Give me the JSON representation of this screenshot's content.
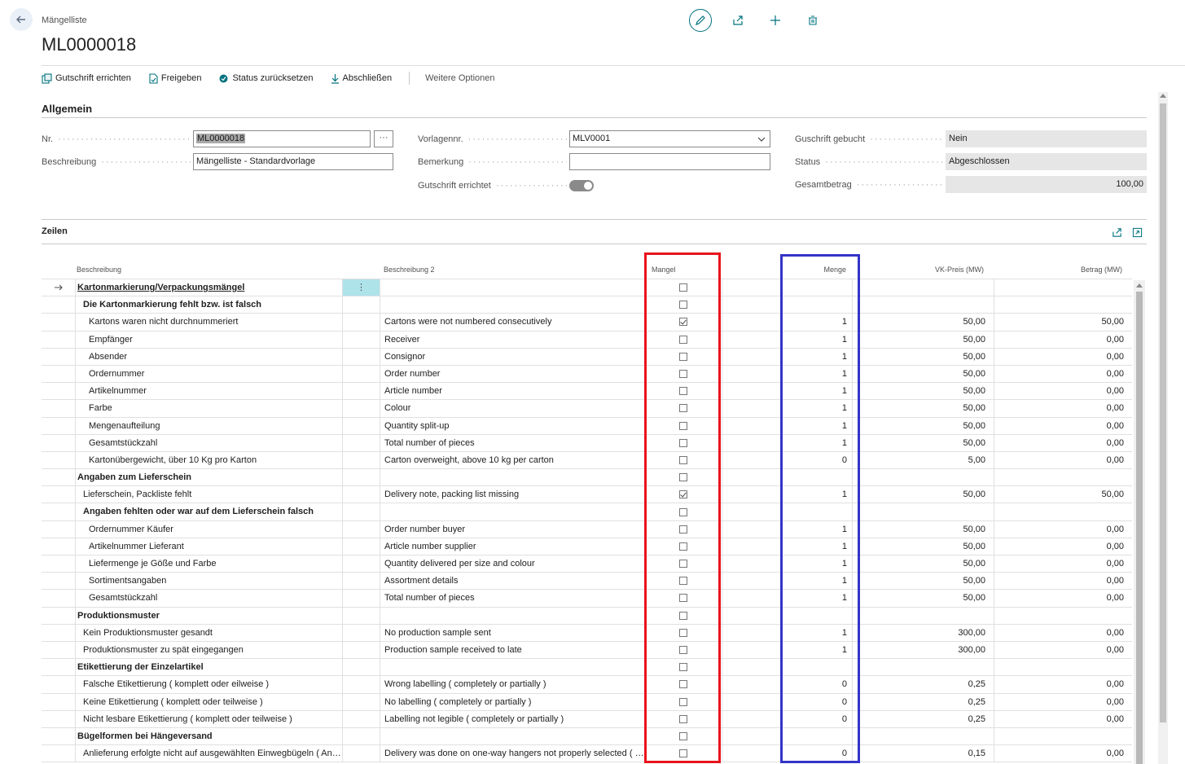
{
  "header": {
    "breadcrumb": "Mängelliste",
    "title": "ML0000018"
  },
  "toolbar": {
    "gutschrift": "Gutschrift errichten",
    "freigeben": "Freigeben",
    "status_reset": "Status zurücksetzen",
    "abschliessen": "Abschließen",
    "weitere": "Weitere Optionen"
  },
  "allgemein": {
    "section_title": "Allgemein",
    "nr_label": "Nr.",
    "nr_value": "ML0000018",
    "beschreibung_label": "Beschreibung",
    "beschreibung_value": "Mängelliste - Standardvorlage",
    "vorlagennr_label": "Vorlagennr.",
    "vorlagennr_value": "MLV0001",
    "bemerkung_label": "Bemerkung",
    "bemerkung_value": "",
    "gutschrift_errichtet_label": "Gutschrift errichtet",
    "guschrift_gebucht_label": "Guschrift gebucht",
    "guschrift_gebucht_value": "Nein",
    "status_label": "Status",
    "status_value": "Abgeschlossen",
    "gesamtbetrag_label": "Gesamtbetrag",
    "gesamtbetrag_value": "100,00"
  },
  "zeilen": {
    "section_title": "Zeilen",
    "columns": {
      "beschreibung": "Beschreibung",
      "beschreibung2": "Beschreibung 2",
      "mangel": "Mangel",
      "menge": "Menge",
      "vk_preis": "VK-Preis (MW)",
      "betrag": "Betrag (MW)"
    },
    "rows": [
      {
        "desc": "Kartonmarkierung/Verpackungsmängel",
        "desc2": "",
        "checked": false,
        "menge": "",
        "vk": "",
        "betrag": "",
        "style": "link",
        "indent": 0,
        "current": true
      },
      {
        "desc": "Die Kartonmarkierung fehlt bzw. ist falsch",
        "desc2": "",
        "checked": false,
        "menge": "",
        "vk": "",
        "betrag": "",
        "style": "bold",
        "indent": 1
      },
      {
        "desc": "Kartons waren nicht durchnummeriert",
        "desc2": "Cartons were not numbered consecutively",
        "checked": true,
        "menge": "1",
        "vk": "50,00",
        "betrag": "50,00",
        "style": "",
        "indent": 2
      },
      {
        "desc": "Empfänger",
        "desc2": "Receiver",
        "checked": false,
        "menge": "1",
        "vk": "50,00",
        "betrag": "0,00",
        "style": "",
        "indent": 2
      },
      {
        "desc": "Absender",
        "desc2": "Consignor",
        "checked": false,
        "menge": "1",
        "vk": "50,00",
        "betrag": "0,00",
        "style": "",
        "indent": 2
      },
      {
        "desc": "Ordernummer",
        "desc2": "Order number",
        "checked": false,
        "menge": "1",
        "vk": "50,00",
        "betrag": "0,00",
        "style": "",
        "indent": 2
      },
      {
        "desc": "Artikelnummer",
        "desc2": "Article number",
        "checked": false,
        "menge": "1",
        "vk": "50,00",
        "betrag": "0,00",
        "style": "",
        "indent": 2
      },
      {
        "desc": "Farbe",
        "desc2": "Colour",
        "checked": false,
        "menge": "1",
        "vk": "50,00",
        "betrag": "0,00",
        "style": "",
        "indent": 2
      },
      {
        "desc": "Mengenaufteilung",
        "desc2": "Quantity split-up",
        "checked": false,
        "menge": "1",
        "vk": "50,00",
        "betrag": "0,00",
        "style": "",
        "indent": 2
      },
      {
        "desc": "Gesamtstückzahl",
        "desc2": "Total number of pieces",
        "checked": false,
        "menge": "1",
        "vk": "50,00",
        "betrag": "0,00",
        "style": "",
        "indent": 2
      },
      {
        "desc": "Kartonübergewicht, über 10 Kg pro Karton",
        "desc2": "Carton overweight, above 10 kg per carton",
        "checked": false,
        "menge": "0",
        "vk": "5,00",
        "betrag": "0,00",
        "style": "",
        "indent": 2
      },
      {
        "desc": "Angaben zum Lieferschein",
        "desc2": "",
        "checked": false,
        "menge": "",
        "vk": "",
        "betrag": "",
        "style": "bold",
        "indent": 0
      },
      {
        "desc": "Lieferschein, Packliste fehlt",
        "desc2": "Delivery note, packing list missing",
        "checked": true,
        "menge": "1",
        "vk": "50,00",
        "betrag": "50,00",
        "style": "",
        "indent": 1
      },
      {
        "desc": "Angaben fehlten oder war auf dem Lieferschein falsch",
        "desc2": "",
        "checked": false,
        "menge": "",
        "vk": "",
        "betrag": "",
        "style": "bold",
        "indent": 1
      },
      {
        "desc": "Ordernummer Käufer",
        "desc2": "Order number buyer",
        "checked": false,
        "menge": "1",
        "vk": "50,00",
        "betrag": "0,00",
        "style": "",
        "indent": 2
      },
      {
        "desc": "Artikelnummer Lieferant",
        "desc2": "Article number supplier",
        "checked": false,
        "menge": "1",
        "vk": "50,00",
        "betrag": "0,00",
        "style": "",
        "indent": 2
      },
      {
        "desc": "Liefermenge je Göße und Farbe",
        "desc2": "Quantity delivered per size and colour",
        "checked": false,
        "menge": "1",
        "vk": "50,00",
        "betrag": "0,00",
        "style": "",
        "indent": 2
      },
      {
        "desc": "Sortimentsangaben",
        "desc2": "Assortment details",
        "checked": false,
        "menge": "1",
        "vk": "50,00",
        "betrag": "0,00",
        "style": "",
        "indent": 2
      },
      {
        "desc": "Gesamtstückzahl",
        "desc2": "Total number of pieces",
        "checked": false,
        "menge": "1",
        "vk": "50,00",
        "betrag": "0,00",
        "style": "",
        "indent": 2
      },
      {
        "desc": "Produktionsmuster",
        "desc2": "",
        "checked": false,
        "menge": "",
        "vk": "",
        "betrag": "",
        "style": "bold",
        "indent": 0
      },
      {
        "desc": "Kein Produktionsmuster gesandt",
        "desc2": "No production sample sent",
        "checked": false,
        "menge": "1",
        "vk": "300,00",
        "betrag": "0,00",
        "style": "",
        "indent": 1
      },
      {
        "desc": "Produktionsmuster zu spät eingegangen",
        "desc2": "Production sample received to late",
        "checked": false,
        "menge": "1",
        "vk": "300,00",
        "betrag": "0,00",
        "style": "",
        "indent": 1
      },
      {
        "desc": "Etikettierung der Einzelartikel",
        "desc2": "",
        "checked": false,
        "menge": "",
        "vk": "",
        "betrag": "",
        "style": "bold",
        "indent": 0
      },
      {
        "desc": "Falsche Etikettierung ( komplett oder eilweise )",
        "desc2": "Wrong labelling ( completely or partially )",
        "checked": false,
        "menge": "0",
        "vk": "0,25",
        "betrag": "0,00",
        "style": "",
        "indent": 1
      },
      {
        "desc": "Keine Etikettierung ( komplett oder teilweise )",
        "desc2": "No labelling ( completely or partially )",
        "checked": false,
        "menge": "0",
        "vk": "0,25",
        "betrag": "0,00",
        "style": "",
        "indent": 1
      },
      {
        "desc": "Nicht lesbare Etikettierung ( komplett oder teilweise )",
        "desc2": "Labelling not legible ( completely or partially )",
        "checked": false,
        "menge": "0",
        "vk": "0,25",
        "betrag": "0,00",
        "style": "",
        "indent": 1
      },
      {
        "desc": "Bügelformen bei Hängeversand",
        "desc2": "",
        "checked": false,
        "menge": "",
        "vk": "",
        "betrag": "",
        "style": "bold",
        "indent": 0
      },
      {
        "desc": "Anlieferung erfolgte nicht auf ausgewählten Einwegbügeln ( Anza...",
        "desc2": "Delivery was done on one-way hangers not properly selected ( Num...",
        "checked": false,
        "menge": "0",
        "vk": "0,15",
        "betrag": "0,00",
        "style": "",
        "indent": 1
      }
    ]
  },
  "colors": {
    "accent": "#00727f",
    "highlight_red": "#e8141c",
    "highlight_blue": "#3434c8",
    "selected_cell": "#aee3ea"
  }
}
